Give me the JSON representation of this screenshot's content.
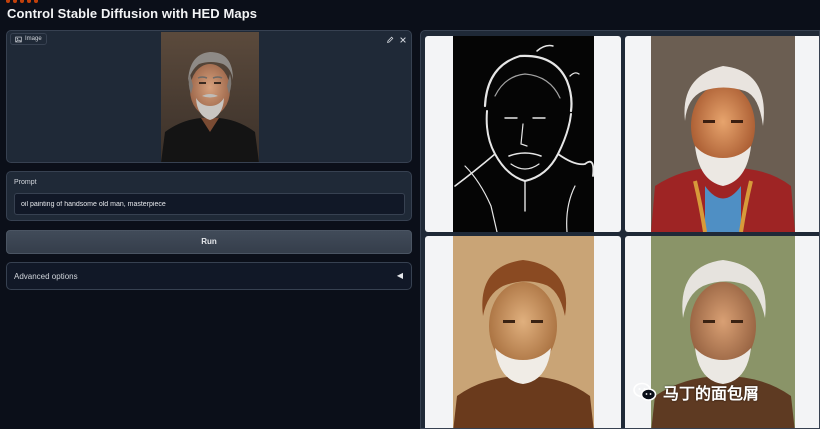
{
  "app": {
    "title": "Control Stable Diffusion with HED Maps"
  },
  "image_input": {
    "label": "Image",
    "tools": [
      "edit-icon",
      "close-icon"
    ]
  },
  "prompt": {
    "label": "Prompt",
    "value": "oil painting of handsome old man, masterpiece",
    "placeholder": ""
  },
  "run": {
    "label": "Run"
  },
  "advanced": {
    "label": "Advanced options",
    "toggle": "◀"
  },
  "gallery": {
    "items": [
      "hed-edge-map",
      "result-1",
      "result-2",
      "result-3"
    ]
  },
  "watermark": {
    "text": "马丁的面包屑"
  },
  "colors": {
    "background": "#0b0f19",
    "panel": "#1f2937",
    "border": "#374151",
    "button": "#374151"
  }
}
